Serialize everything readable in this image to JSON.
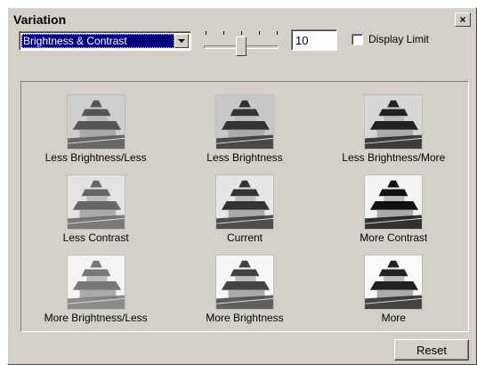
{
  "window": {
    "title": "Variation"
  },
  "controls": {
    "mode_select": "Brightness & Contrast",
    "amount_value": "10",
    "slider_fraction": 0.5,
    "display_limit_label": "Display Limit",
    "display_limit_checked": false
  },
  "variations": [
    {
      "label": "Less Brightness/Less"
    },
    {
      "label": "Less Brightness"
    },
    {
      "label": "Less Brightness/More"
    },
    {
      "label": "Less Contrast"
    },
    {
      "label": "Current"
    },
    {
      "label": "More Contrast"
    },
    {
      "label": "More Brightness/Less"
    },
    {
      "label": "More Brightness"
    },
    {
      "label": "More"
    }
  ],
  "buttons": {
    "reset": "Reset"
  },
  "icons": {
    "close": "close-icon",
    "dropdown": "chevron-down-icon"
  }
}
